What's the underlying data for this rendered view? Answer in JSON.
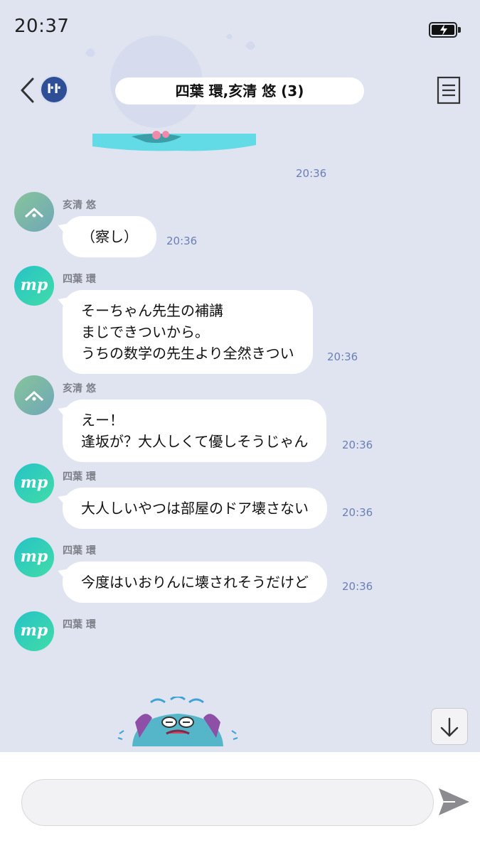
{
  "status_bar": {
    "time": "20:37"
  },
  "header": {
    "title": "四葉 環,亥清 悠 (3)",
    "group_icon_text": "ŀŀ"
  },
  "sticker_top_time": "20:36",
  "messages": [
    {
      "sender": "亥清 悠",
      "lines": [
        "（察し）"
      ],
      "time": "20:36"
    },
    {
      "sender": "四葉 環",
      "lines": [
        "そーちゃん先生の補講",
        "まじできついから。",
        "うちの数学の先生より全然きつい"
      ],
      "time": "20:36"
    },
    {
      "sender": "亥清 悠",
      "lines": [
        "えー！",
        "逢坂が？大人しくて優しそうじゃん"
      ],
      "time": "20:36"
    },
    {
      "sender": "四葉 環",
      "lines": [
        "大人しいやつは部屋のドア壊さない"
      ],
      "time": "20:36"
    },
    {
      "sender": "四葉 環",
      "lines": [
        "今度はいおりんに壊されそうだけど"
      ],
      "time": "20:36"
    },
    {
      "sender": "四葉 環"
    }
  ],
  "avatar_text": {
    "tamaki": "mp"
  },
  "input": {
    "placeholder": ""
  },
  "colors": {
    "background": "#e0e4f1",
    "timestamp": "#6b7fb5",
    "avatar_green": "#87c49a",
    "avatar_teal": "#26c3c7",
    "group_icon": "#2e4f96"
  },
  "icons": {
    "back": "chevron-left-icon",
    "menu": "menu-icon",
    "scroll": "arrow-down-icon",
    "send": "send-icon"
  }
}
